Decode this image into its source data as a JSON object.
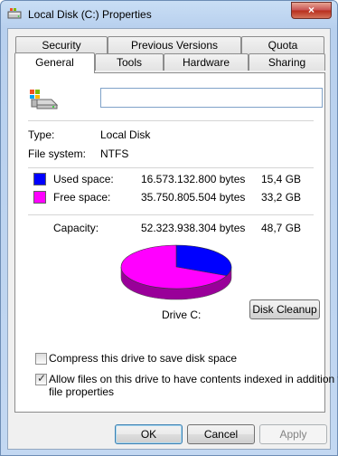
{
  "window": {
    "title": "Local Disk (C:) Properties",
    "close_glyph": "×"
  },
  "tabs": {
    "row1": [
      "Security",
      "Previous Versions",
      "Quota"
    ],
    "row2": [
      "General",
      "Tools",
      "Hardware",
      "Sharing"
    ],
    "active": "General"
  },
  "general": {
    "name_value": "",
    "type_label": "Type:",
    "type_value": "Local Disk",
    "fs_label": "File system:",
    "fs_value": "NTFS",
    "used": {
      "label": "Used space:",
      "bytes": "16.573.132.800 bytes",
      "size": "15,4 GB",
      "color": "#0000ff"
    },
    "free": {
      "label": "Free space:",
      "bytes": "35.750.805.504 bytes",
      "size": "33,2 GB",
      "color": "#ff00ff"
    },
    "capacity": {
      "label": "Capacity:",
      "bytes": "52.323.938.304 bytes",
      "size": "48,7 GB"
    },
    "pie_used_fraction": 0.3167,
    "drive_label": "Drive C:",
    "cleanup_label": "Disk Cleanup",
    "compress": {
      "label": "Compress this drive to save disk space",
      "checked": false
    },
    "index": {
      "label_line1": "Allow files on this drive to have contents indexed in addition to",
      "label_line2": "file properties",
      "checked": true
    }
  },
  "buttons": {
    "ok": "OK",
    "cancel": "Cancel",
    "apply": "Apply"
  },
  "icons": {
    "drive": "drive-icon",
    "close": "close-icon"
  }
}
